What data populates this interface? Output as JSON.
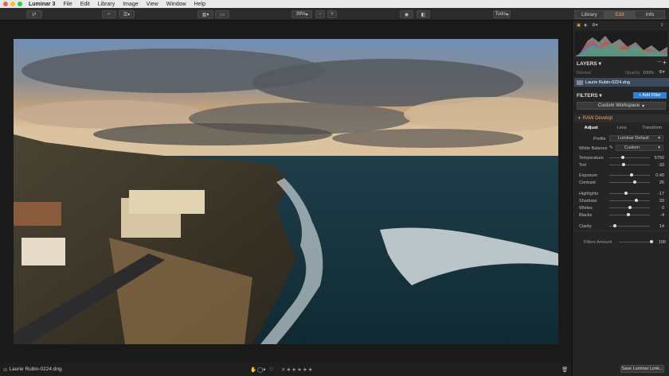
{
  "menubar": {
    "app": "Luminar 3",
    "items": [
      "File",
      "Edit",
      "Library",
      "Image",
      "View",
      "Window",
      "Help"
    ]
  },
  "toolbar": {
    "zoom": "39%",
    "zoom_out": "−",
    "zoom_in": "+",
    "tools_label": "Tools",
    "tabs": [
      "Library",
      "Edit",
      "Info"
    ]
  },
  "layers": {
    "title": "LAYERS",
    "blend_mode": "Normal",
    "opacity_label": "Opacity",
    "opacity_value": "100%",
    "layer_name": "Laurie Rubin-0224.dng"
  },
  "filters": {
    "title": "FILTERS",
    "add_filter_label": "+ Add Filter",
    "workspace": "Custom Workspace",
    "raw_develop": "RAW Develop",
    "subtabs": [
      "Adjust",
      "Lens",
      "Transform"
    ],
    "profile_label": "Profile",
    "profile_value": "Luminar Default",
    "wb_label": "White Balance",
    "wb_value": "Custom",
    "sliders1": [
      {
        "label": "Temperature",
        "value": "5750",
        "pos": 0.33
      },
      {
        "label": "Tint",
        "value": "-33",
        "pos": 0.35
      }
    ],
    "sliders2": [
      {
        "label": "Exposure",
        "value": "0.40",
        "pos": 0.55
      },
      {
        "label": "Contrast",
        "value": "26",
        "pos": 0.62
      }
    ],
    "sliders3": [
      {
        "label": "Highlights",
        "value": "-17",
        "pos": 0.42
      },
      {
        "label": "Shadows",
        "value": "33",
        "pos": 0.66
      },
      {
        "label": "Whites",
        "value": "0",
        "pos": 0.5
      },
      {
        "label": "Blacks",
        "value": "-4",
        "pos": 0.48
      }
    ],
    "sliders4": [
      {
        "label": "Clarity",
        "value": "14",
        "pos": 0.14
      }
    ],
    "amount_label": "Filters Amount",
    "amount_value": "100",
    "amount_pos": 1.0
  },
  "status": {
    "filename": "Laurie Rubin-0224.dng",
    "save_look": "Save Luminar Look..."
  },
  "colors": {
    "accent": "#2f7fd9",
    "raw_develop": "#e8a44a"
  }
}
